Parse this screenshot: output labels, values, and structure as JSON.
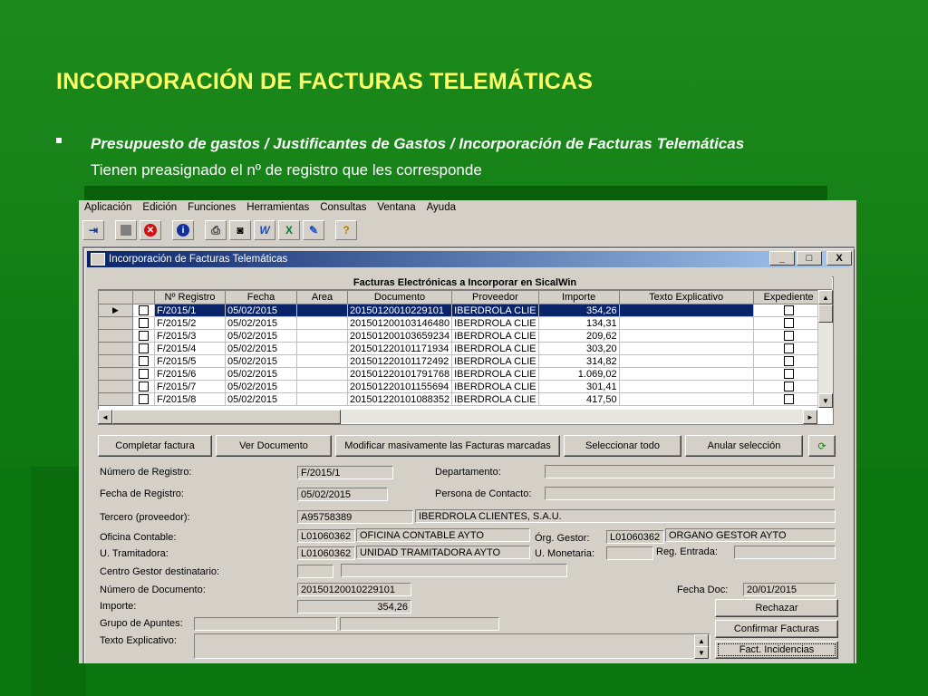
{
  "slide": {
    "title": "INCORPORACIÓN DE FACTURAS TELEMÁTICAS",
    "bullet_line1": "Presupuesto de gastos / Justificantes de Gastos / Incorporación de Facturas Telemáticas",
    "bullet_line2": "Tienen preasignado el nº de registro que les corresponde"
  },
  "menu": [
    "Aplicación",
    "Edición",
    "Funciones",
    "Herramientas",
    "Consultas",
    "Ventana",
    "Ayuda"
  ],
  "toolbar_icons": [
    "exit-icon",
    "stop-icon",
    "close-red-icon",
    "info-icon",
    "print-icon",
    "find-icon",
    "word-icon",
    "excel-icon",
    "edit-icon",
    "help-icon"
  ],
  "window": {
    "title": "Incorporación de Facturas Telemáticas",
    "min": "_",
    "max": "□",
    "close": "X"
  },
  "grid": {
    "caption": "Facturas Electrónicas a Incorporar en SicalWin",
    "headers": [
      "Nº Registro",
      "Fecha",
      "Area",
      "Documento",
      "Proveedor",
      "Importe",
      "Texto Explicativo",
      "Expediente"
    ],
    "rows": [
      [
        "F/2015/1",
        "05/02/2015",
        "",
        "20150120010229101",
        "IBERDROLA CLIE",
        "354,26",
        ""
      ],
      [
        "F/2015/2",
        "05/02/2015",
        "",
        "201501200103146480",
        "IBERDROLA CLIE",
        "134,31",
        ""
      ],
      [
        "F/2015/3",
        "05/02/2015",
        "",
        "201501200103659234",
        "IBERDROLA CLIE",
        "209,62",
        ""
      ],
      [
        "F/2015/4",
        "05/02/2015",
        "",
        "201501220101171934",
        "IBERDROLA CLIE",
        "303,20",
        ""
      ],
      [
        "F/2015/5",
        "05/02/2015",
        "",
        "201501220101172492",
        "IBERDROLA CLIE",
        "314,82",
        ""
      ],
      [
        "F/2015/6",
        "05/02/2015",
        "",
        "201501220101791768",
        "IBERDROLA CLIE",
        "1.069,02",
        ""
      ],
      [
        "F/2015/7",
        "05/02/2015",
        "",
        "201501220101155694",
        "IBERDROLA CLIE",
        "301,41",
        ""
      ],
      [
        "F/2015/8",
        "05/02/2015",
        "",
        "201501220101088352",
        "IBERDROLA CLIE",
        "417,50",
        ""
      ]
    ]
  },
  "buttons": [
    "Completar factura",
    "Ver Documento",
    "Modificar masivamente las Facturas marcadas",
    "Seleccionar todo",
    "Anular selección"
  ],
  "form": {
    "num_registro_label": "Número de Registro:",
    "num_registro": "F/2015/1",
    "departamento_label": "Departamento:",
    "departamento": "",
    "fecha_registro_label": "Fecha de Registro:",
    "fecha_registro": "05/02/2015",
    "persona_contacto_label": "Persona de Contacto:",
    "persona_contacto": "",
    "tercero_label": "Tercero (proveedor):",
    "tercero_nif": "A95758389",
    "tercero_nombre": "IBERDROLA CLIENTES, S.A.U.",
    "oficina_label": "Oficina Contable:",
    "oficina_cod": "L01060362",
    "oficina_nombre": "OFICINA CONTABLE AYTO",
    "organo_label": "Órg. Gestor:",
    "organo_cod": "L01060362",
    "organo_nombre": "ORGANO GESTOR AYTO",
    "unidad_label": "U. Tramitadora:",
    "unidad_cod": "L01060362",
    "unidad_nombre": "UNIDAD TRAMITADORA AYTO",
    "moneda_label": "U. Monetaria:",
    "moneda": "",
    "reg_entrada_label": "Reg. Entrada:",
    "reg_entrada": "",
    "centro_label": "Centro Gestor destinatario:",
    "centro_cod": "",
    "centro_nombre": "",
    "num_doc_label": "Número de Documento:",
    "num_doc": "20150120010229101",
    "fecha_doc_label": "Fecha Doc:",
    "fecha_doc": "20/01/2015",
    "importe_label": "Importe:",
    "importe": "354,26",
    "grupo_label": "Grupo de Apuntes:",
    "grupo_a": "",
    "grupo_b": "",
    "texto_label": "Texto Explicativo:",
    "texto": ""
  },
  "actions": {
    "rechazar": "Rechazar",
    "confirmar": "Confirmar Facturas",
    "incidencias": "Fact. Incidencias"
  }
}
